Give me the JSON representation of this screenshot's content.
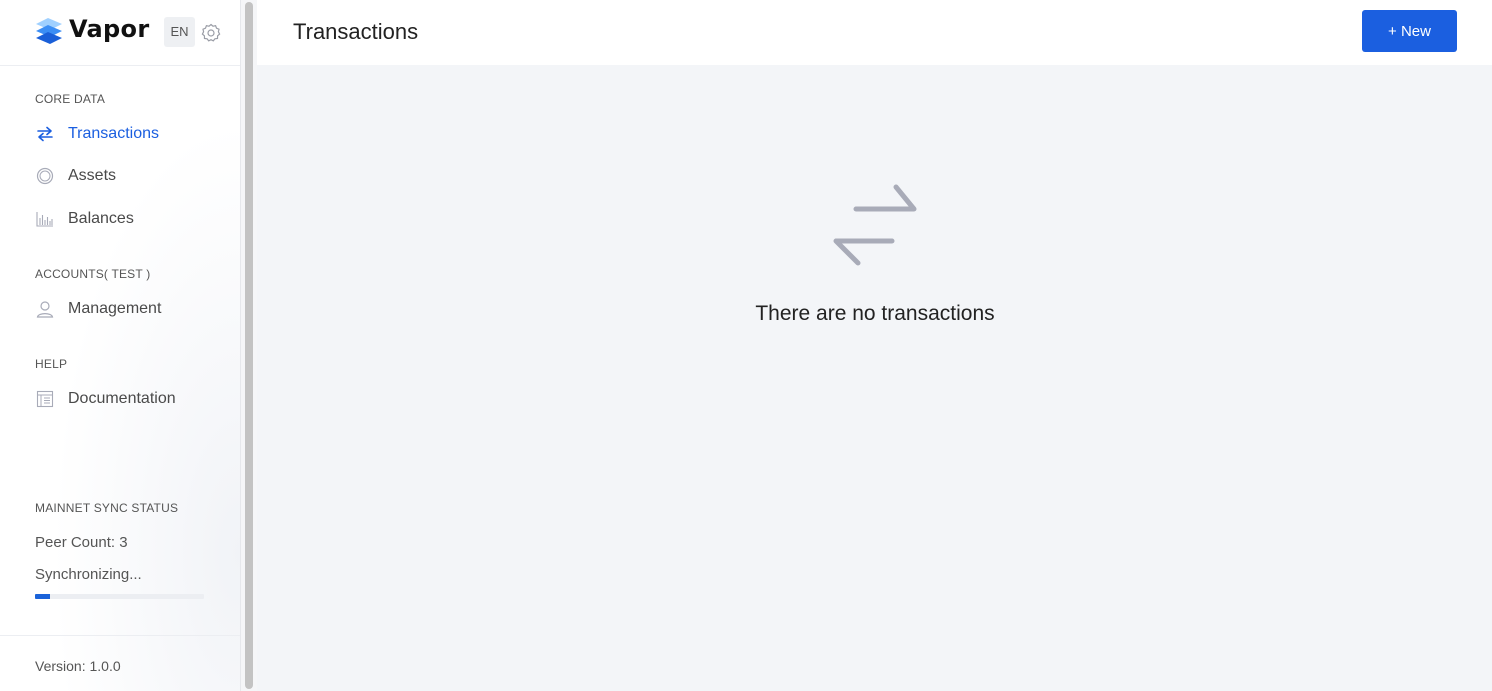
{
  "brand": {
    "name": "Vapor",
    "language": "EN"
  },
  "sidebar": {
    "sections": [
      {
        "title": "CORE DATA",
        "items": [
          {
            "label": "Transactions",
            "icon": "transfer-icon",
            "active": true
          },
          {
            "label": "Assets",
            "icon": "circle-icon",
            "active": false
          },
          {
            "label": "Balances",
            "icon": "bar-chart-icon",
            "active": false
          }
        ]
      },
      {
        "title": "ACCOUNTS( TEST )",
        "items": [
          {
            "label": "Management",
            "icon": "user-icon",
            "active": false
          }
        ]
      },
      {
        "title": "HELP",
        "items": [
          {
            "label": "Documentation",
            "icon": "document-icon",
            "active": false
          }
        ]
      }
    ],
    "sync": {
      "title": "MAINNET SYNC STATUS",
      "peer_count": "Peer Count: 3",
      "status": "Synchronizing...",
      "progress_fraction": 0.09
    },
    "version": "Version: 1.0.0"
  },
  "header": {
    "title": "Transactions",
    "new_button": "+ New"
  },
  "main": {
    "empty_message": "There are no transactions"
  },
  "colors": {
    "accent": "#1b5fe0",
    "icon_gray": "#a8abb8",
    "progress": "#1b63d9"
  }
}
